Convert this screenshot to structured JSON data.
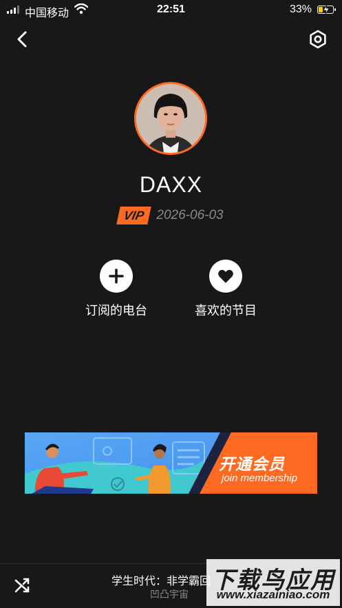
{
  "status_bar": {
    "carrier": "中国移动",
    "time": "22:51",
    "battery_pct": "33%",
    "battery_level": 0.33
  },
  "header": {
    "back_icon": "chevron-left-icon",
    "settings_icon": "hexagon-gear-icon"
  },
  "profile": {
    "username": "DAXX",
    "vip_label": "VIP",
    "vip_expiry": "2026-06-03",
    "accent_color": "#ff6a22"
  },
  "actions": [
    {
      "label": "订阅的电台",
      "icon": "plus-icon"
    },
    {
      "label": "喜欢的节目",
      "icon": "heart-icon"
    }
  ],
  "banner": {
    "title": "开通会员",
    "subtitle": "join membership",
    "bg_color": "#4a9bf0",
    "accent_color": "#ff6a22"
  },
  "player": {
    "title": "学生时代：非学霸回",
    "subtitle": "凹凸宇宙",
    "shuffle_icon": "shuffle-icon"
  },
  "watermark": {
    "main": "下载鸟应用",
    "url": "www.xiazainiao.com"
  }
}
